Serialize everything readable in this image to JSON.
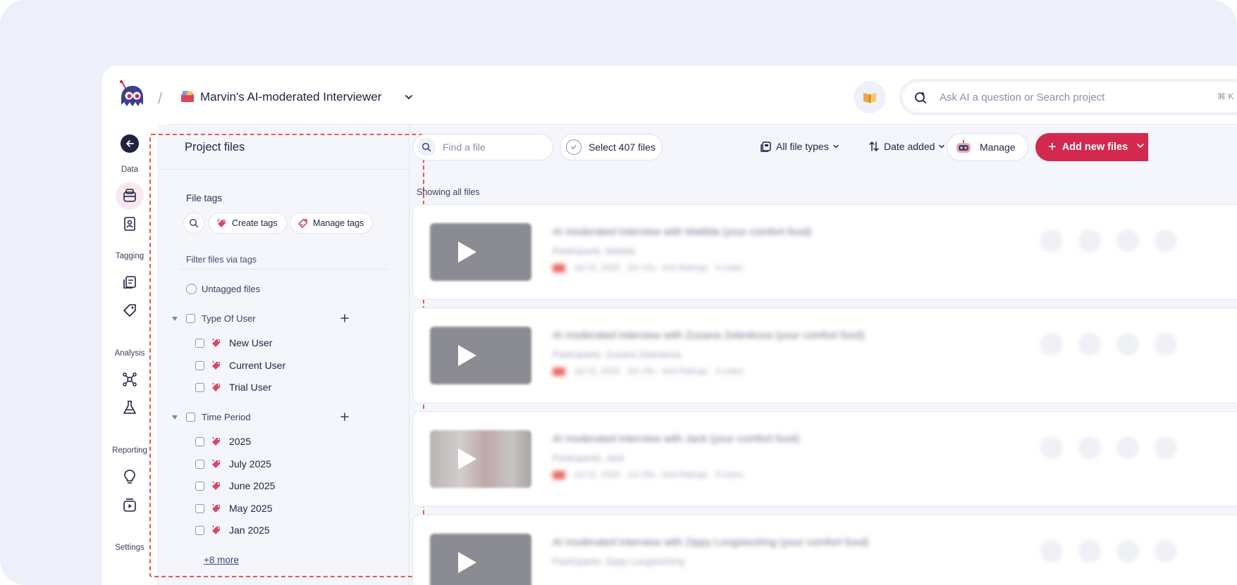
{
  "header": {
    "project_title": "Marvin's AI-moderated Interviewer",
    "breadcrumb_separator": "/",
    "search": {
      "placeholder": "Ask AI a question or Search project",
      "shortcut": "⌘ K"
    }
  },
  "rail": {
    "sections": [
      "Data",
      "Tagging",
      "Analysis",
      "Reporting",
      "Settings"
    ]
  },
  "panel": {
    "title": "Project files",
    "file_tags_label": "File tags",
    "create_tags_label": "Create tags",
    "manage_tags_label": "Manage tags",
    "filter_label": "Filter files via tags",
    "untagged_label": "Untagged files",
    "groups": [
      {
        "name": "Type Of User",
        "tags": [
          "New User",
          "Current User",
          "Trial User"
        ]
      },
      {
        "name": "Time Period",
        "tags": [
          "2025",
          "July 2025",
          "June 2025",
          "May 2025",
          "Jan 2025"
        ]
      }
    ],
    "more_link": "+8 more"
  },
  "toolbar": {
    "find_placeholder": "Find a file",
    "select_label": "Select 407 files",
    "file_types_label": "All file types",
    "sort_label": "Date added",
    "manage_label": "Manage",
    "add_label": "Add new files"
  },
  "files": {
    "showing_label": "Showing all files",
    "items": [
      {
        "title": "AI moderated interview with Matilda (your comfort food)",
        "participants": "Participants: Matilda",
        "meta": "Jul 31, 2025  ·  2m 15s  ·  Anti Ratings  ·  4 notes"
      },
      {
        "title": "AI moderated interview with Zuzana Zelenkova (your comfort food)",
        "participants": "Participants: Zuzana Zelenkova",
        "meta": "Jul 31, 2025  ·  2m 19s  ·  Anti Ratings  ·  3 notes"
      },
      {
        "title": "AI moderated interview with Jack (your comfort food)",
        "participants": "Participants: Jack",
        "meta": "Jul 31, 2025  ·  1m 20s  ·  Anti Ratings  ·  3 notes"
      },
      {
        "title": "AI moderated interview with Zippy Longstocking (your comfort food)",
        "participants": "Participants: Zippy Longstocking",
        "meta": ""
      }
    ]
  },
  "colors": {
    "accent": "#d3294f",
    "dashed_outline": "#e8584f",
    "ink": "#1f2340"
  }
}
